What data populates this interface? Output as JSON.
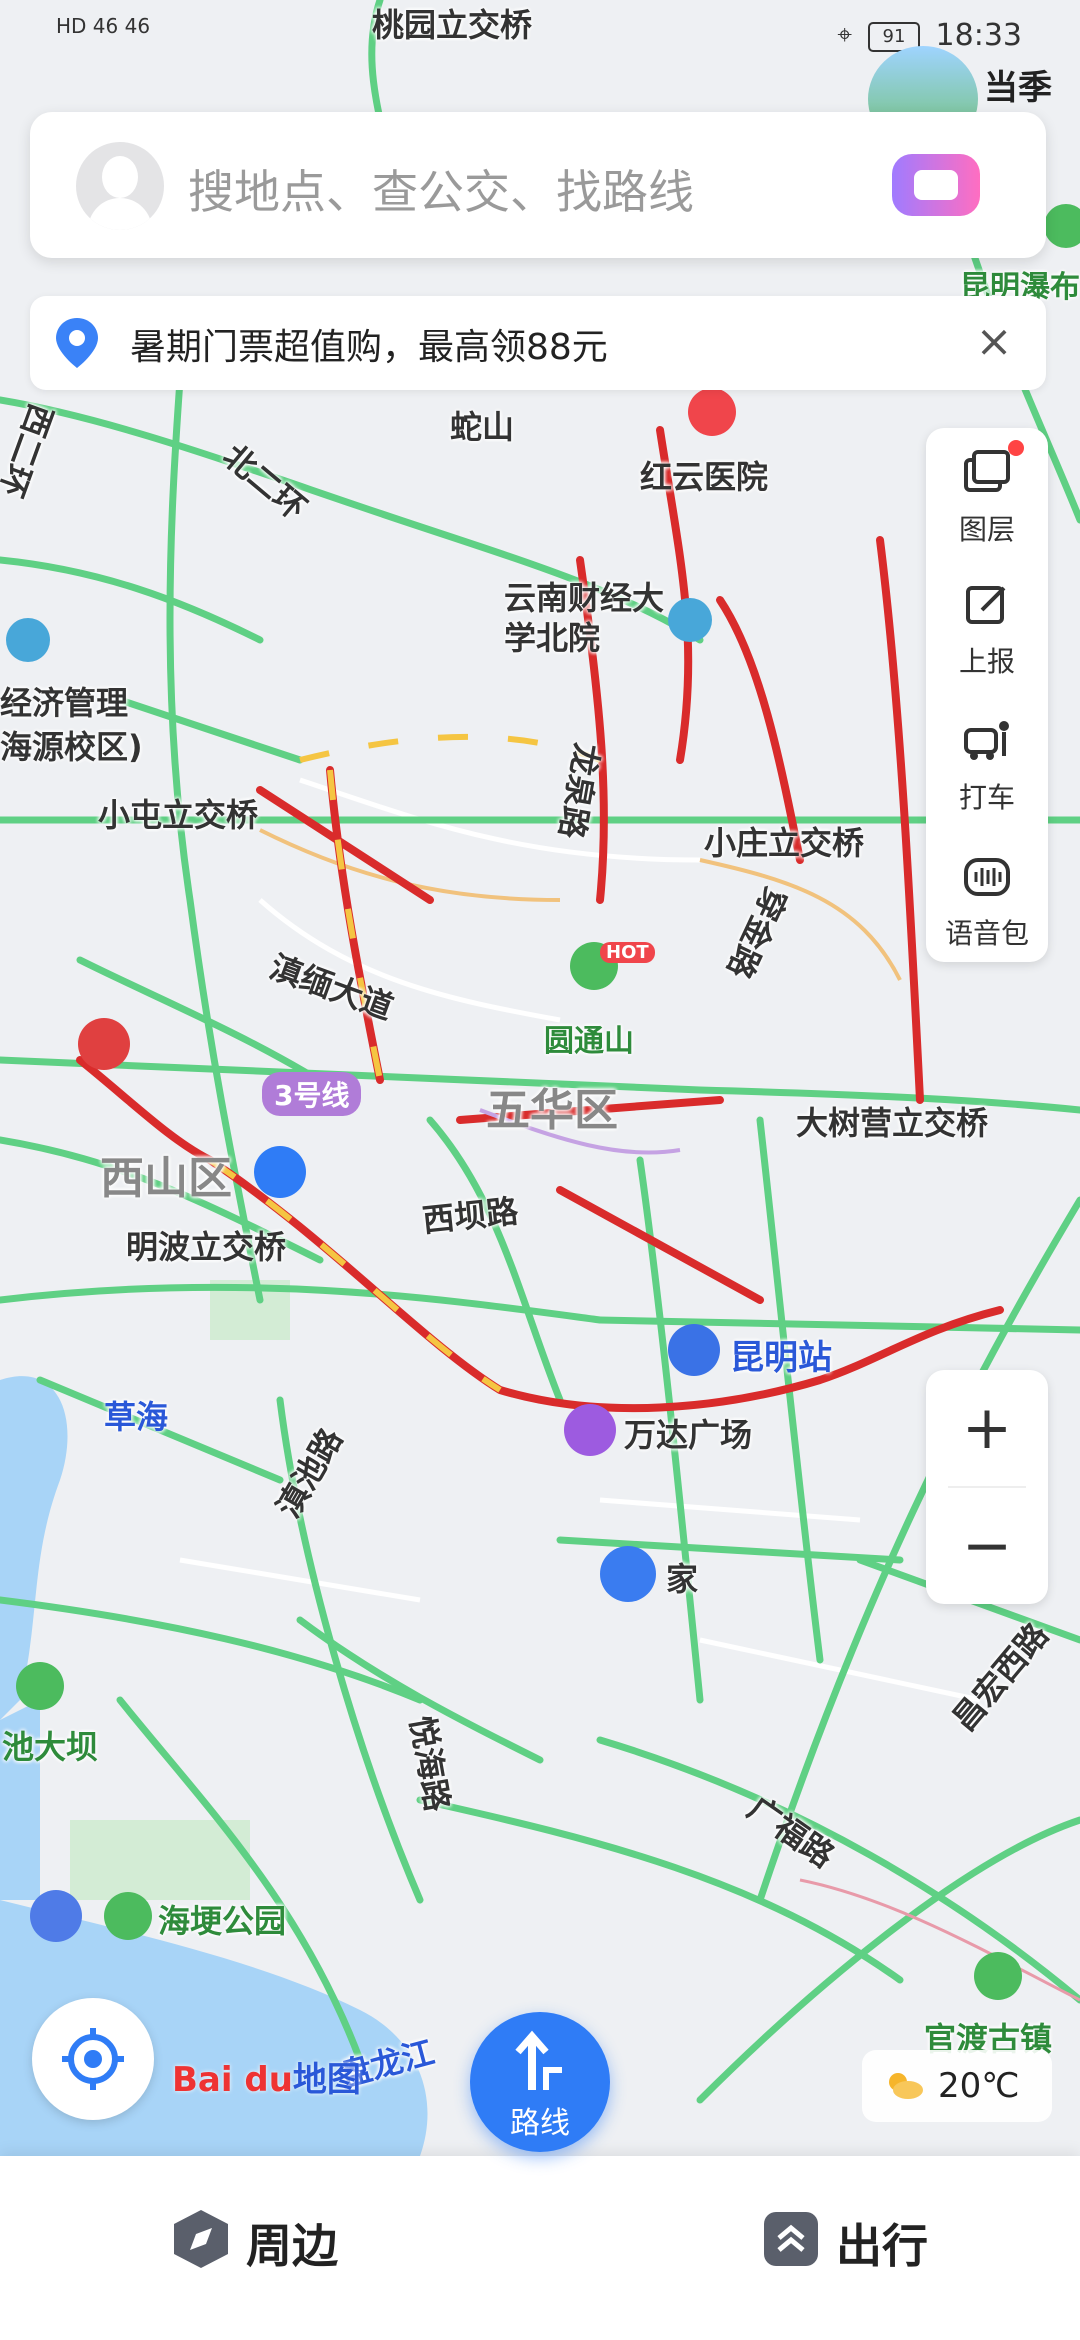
{
  "status_bar": {
    "left_text": "HD 46 46",
    "battery": "91",
    "time": "18:33"
  },
  "teaser": {
    "text": "当季热"
  },
  "search": {
    "placeholder": "搜地点、查公交、找路线"
  },
  "promo": {
    "text": "暑期门票超值购，最高领88元",
    "close": "×"
  },
  "toolbar": {
    "items": [
      {
        "label": "图层",
        "icon": "layers-icon"
      },
      {
        "label": "上报",
        "icon": "report-icon"
      },
      {
        "label": "打车",
        "icon": "taxi-icon"
      },
      {
        "label": "语音包",
        "icon": "voice-pack-icon"
      }
    ]
  },
  "zoom": {
    "plus": "+",
    "minus": "−"
  },
  "map": {
    "labels": {
      "taoyuan": "桃园立交桥",
      "shishan": "蛇山",
      "hongyun": "红云医院",
      "beierhuan": "北二环",
      "xierhuan": "西二环",
      "caijing": "云南财经大学北院",
      "jingji": "经济管理",
      "haiyuan": "海源校区)",
      "xiaotun": "小屯立交桥",
      "longquan": "龙泉路",
      "xiaozhuang": "小庄立交桥",
      "chuanjin": "穿金路",
      "dianmian": "滇缅大道",
      "yuantong": "圆通山",
      "line3": "3号线",
      "wuhua": "五华区",
      "dashuying": "大树营立交桥",
      "xishan": "西山区",
      "mingbo": "明波立交桥",
      "xiba": "西坝路",
      "kunming_station": "昆明站",
      "caohai": "草海",
      "wanda": "万达广场",
      "dianchi_rd": "滇池路",
      "home": "家",
      "changhong": "昌宏西路",
      "daba": "池大坝",
      "yuehai": "悦海路",
      "guangfu": "广福路",
      "haigeng": "海埂公园",
      "panlong": "盘龙江",
      "guandu": "官渡古镇",
      "kunming_waterfall": "昆明瀑布",
      "hot": "HOT"
    }
  },
  "logo": {
    "brand": "Bai du",
    "suffix": "地图"
  },
  "weather": {
    "temp": "20℃"
  },
  "bottom_nav": {
    "nearby": "周边",
    "route": "路线",
    "travel": "出行"
  }
}
